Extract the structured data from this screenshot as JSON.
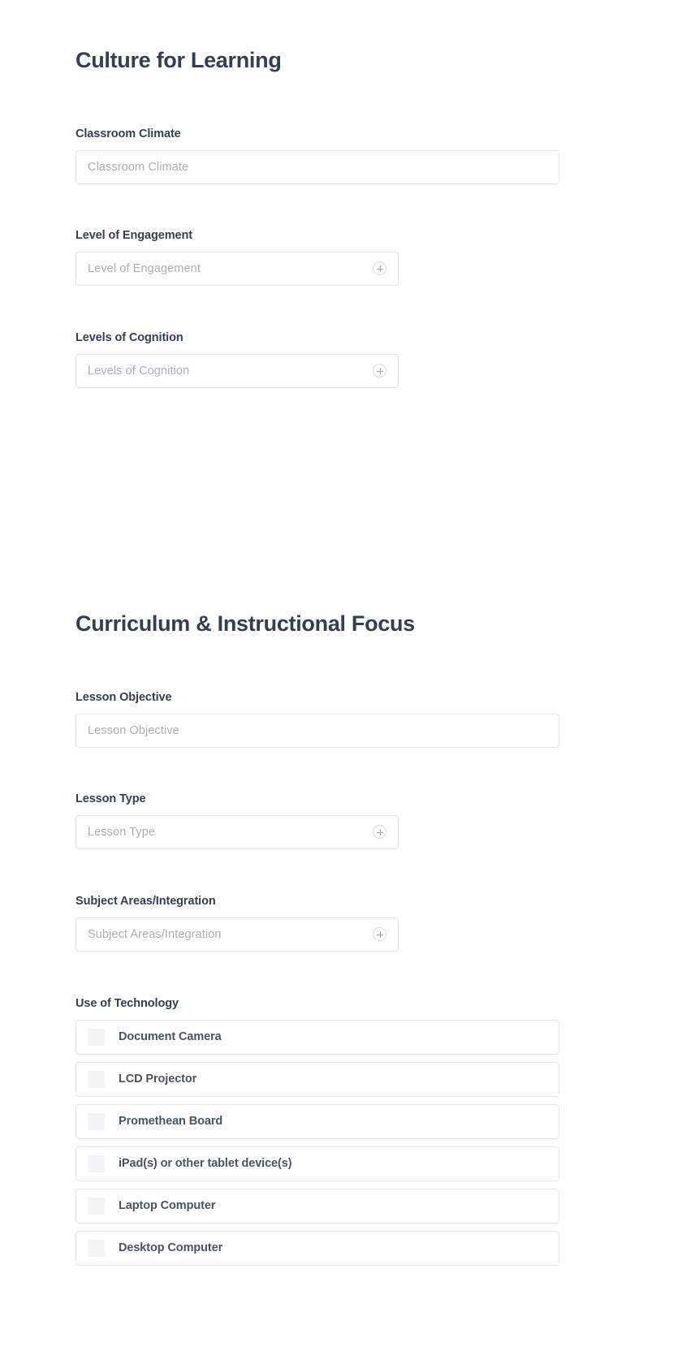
{
  "sections": [
    {
      "title": "Culture for Learning",
      "fields": [
        {
          "label": "Classroom Climate",
          "placeholder": "Classroom Climate",
          "type": "text",
          "width": "wide",
          "icon": null
        },
        {
          "label": "Level of Engagement",
          "placeholder": "Level of Engagement",
          "type": "tag",
          "width": "tag",
          "icon": "plus-circle-icon"
        },
        {
          "label": "Levels of Cognition",
          "placeholder": "Levels of Cognition",
          "type": "tag",
          "width": "tag",
          "icon": "plus-circle-icon"
        }
      ]
    },
    {
      "title": "Curriculum & Instructional Focus",
      "fields": [
        {
          "label": "Lesson Objective",
          "placeholder": "Lesson Objective",
          "type": "text",
          "width": "wide",
          "icon": null
        },
        {
          "label": "Lesson Type",
          "placeholder": "Lesson Type",
          "type": "tag",
          "width": "tag",
          "icon": "plus-circle-icon"
        },
        {
          "label": "Subject Areas/Integration",
          "placeholder": "Subject Areas/Integration",
          "type": "tag",
          "width": "tag",
          "icon": "plus-circle-icon"
        }
      ],
      "checkbox_group": {
        "label": "Use of Technology",
        "items": [
          {
            "label": "Document Camera",
            "checked": false
          },
          {
            "label": "LCD Projector",
            "checked": false
          },
          {
            "label": "Promethean Board",
            "checked": false
          },
          {
            "label": "iPad(s) or other tablet device(s)",
            "checked": false
          },
          {
            "label": "Laptop Computer",
            "checked": false
          },
          {
            "label": "Desktop Computer",
            "checked": false
          }
        ]
      }
    }
  ],
  "colors": {
    "heading": "#333f50",
    "label": "#333f50",
    "placeholder": "#a9aeb6",
    "border": "#e3e5e8",
    "checkbox_fill": "#f2f3f5",
    "checkbox_label": "#4a5360",
    "background": "#ffffff"
  }
}
